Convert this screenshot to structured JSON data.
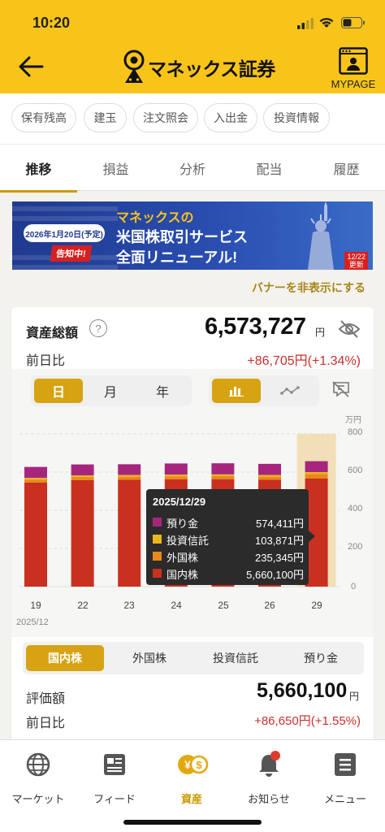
{
  "status_bar": {
    "time": "10:20"
  },
  "header": {
    "brand": "マネックス証券",
    "mypage_label": "MYPAGE"
  },
  "quick_links": [
    "保有残高",
    "建玉",
    "注文照会",
    "入出金",
    "投資情報"
  ],
  "tabs": [
    {
      "label": "推移",
      "active": true
    },
    {
      "label": "損益",
      "active": false
    },
    {
      "label": "分析",
      "active": false
    },
    {
      "label": "配当",
      "active": false
    },
    {
      "label": "履歴",
      "active": false
    }
  ],
  "banner": {
    "date": "2026年1月20日(予定)",
    "notice": "告知中!",
    "line1": "マネックスの",
    "line2": "米国株取引サービス",
    "line3": "全面リニューアル!",
    "update_date": "12/22",
    "update_word": "更新"
  },
  "hide_banner_link": "バナーを非表示にする",
  "asset": {
    "title": "資産総額",
    "total": "6,573,727",
    "unit": "円",
    "prev_label": "前日比",
    "prev_change": "+86,705円(+1.34%)"
  },
  "period_toggle": [
    {
      "label": "日",
      "active": true
    },
    {
      "label": "月",
      "active": false
    },
    {
      "label": "年",
      "active": false
    }
  ],
  "tooltip": {
    "date": "2025/12/29",
    "rows": [
      {
        "name": "預り金",
        "value": "574,411円"
      },
      {
        "name": "投資信託",
        "value": "103,871円"
      },
      {
        "name": "外国株",
        "value": "235,345円"
      },
      {
        "name": "国内株",
        "value": "5,660,100円"
      }
    ]
  },
  "chart_data": {
    "type": "bar",
    "stacked": true,
    "title": "",
    "xlabel": "2025/12",
    "ylabel": "万円",
    "ylim": [
      0,
      800
    ],
    "yticks": [
      0,
      200,
      400,
      600,
      800
    ],
    "grid": true,
    "categories": [
      "19",
      "22",
      "23",
      "24",
      "25",
      "26",
      "29"
    ],
    "highlighted_category": "29",
    "colors": {
      "国内株": "#c9301f",
      "外国株": "#e8891a",
      "投資信託": "#e8b61e",
      "預り金": "#a6267e"
    },
    "series": [
      {
        "name": "国内株",
        "values": [
          545,
          558,
          560,
          562,
          563,
          560,
          566
        ]
      },
      {
        "name": "外国株",
        "values": [
          16,
          16,
          16,
          16,
          16,
          16,
          24
        ]
      },
      {
        "name": "投資信託",
        "values": [
          9,
          9,
          9,
          9,
          9,
          9,
          10
        ]
      },
      {
        "name": "預り金",
        "values": [
          57,
          57,
          56,
          58,
          58,
          58,
          57
        ]
      }
    ]
  },
  "asset_type_tabs": [
    {
      "label": "国内株",
      "active": true
    },
    {
      "label": "外国株",
      "active": false
    },
    {
      "label": "投資信託",
      "active": false
    },
    {
      "label": "預り金",
      "active": false
    }
  ],
  "evaluation": {
    "label": "評価額",
    "value": "5,660,100",
    "unit": "円",
    "prev_label": "前日比",
    "prev_change": "+86,650円(+1.55%)"
  },
  "bottom_nav": [
    {
      "label": "マーケット",
      "icon": "globe-icon",
      "active": false
    },
    {
      "label": "フィード",
      "icon": "feed-icon",
      "active": false
    },
    {
      "label": "資産",
      "icon": "assets-icon",
      "active": true
    },
    {
      "label": "お知らせ",
      "icon": "bell-icon",
      "active": false
    },
    {
      "label": "メニュー",
      "icon": "menu-icon",
      "active": false
    }
  ]
}
